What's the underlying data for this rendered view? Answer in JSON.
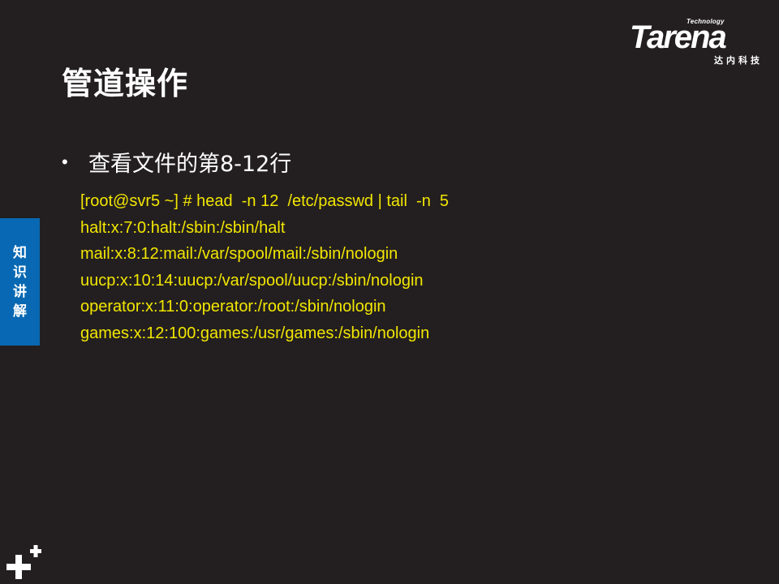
{
  "logo": {
    "technology": "Technology",
    "brand": "Tarena",
    "subtitle": "达内科技"
  },
  "title": "管道操作",
  "bullet": {
    "marker": "•",
    "text": "查看文件的第8-12行"
  },
  "code_lines": [
    "[root@svr5 ~] # head  -n 12  /etc/passwd | tail  -n  5",
    "halt:x:7:0:halt:/sbin:/sbin/halt",
    "mail:x:8:12:mail:/var/spool/mail:/sbin/nologin",
    "uucp:x:10:14:uucp:/var/spool/uucp:/sbin/nologin",
    "operator:x:11:0:operator:/root:/sbin/nologin",
    "games:x:12:100:games:/usr/games:/sbin/nologin"
  ],
  "side_tab": {
    "chars": [
      "知",
      "识",
      "讲",
      "解"
    ]
  },
  "colors": {
    "background": "#231f20",
    "title": "#ffffff",
    "code": "#f2e600",
    "side_tab": "#0868b3"
  },
  "icons": {
    "corner": "plus-plus-icon"
  }
}
